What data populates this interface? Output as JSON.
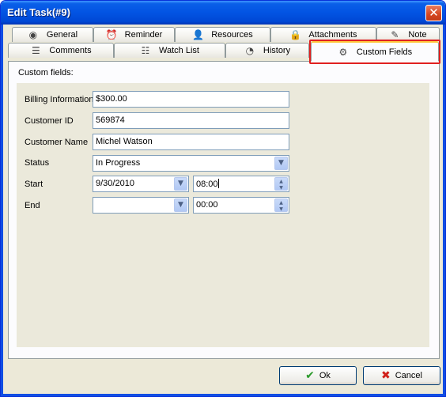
{
  "window": {
    "title": "Edit Task(#9)",
    "close_glyph": "✕"
  },
  "tabs_row1": [
    {
      "label": "General",
      "icon": "globe-icon",
      "glyph": "◉"
    },
    {
      "label": "Reminder",
      "icon": "alarm-clock-icon",
      "glyph": "⏰"
    },
    {
      "label": "Resources",
      "icon": "person-icon",
      "glyph": "👤"
    },
    {
      "label": "Attachments",
      "icon": "lock-icon",
      "glyph": "🔒"
    },
    {
      "label": "Note",
      "icon": "note-pen-icon",
      "glyph": "✎"
    }
  ],
  "tabs_row2": [
    {
      "label": "Comments",
      "icon": "comments-icon",
      "glyph": "☰"
    },
    {
      "label": "Watch List",
      "icon": "watch-list-icon",
      "glyph": "☷"
    },
    {
      "label": "History",
      "icon": "history-clock-icon",
      "glyph": "◔"
    },
    {
      "label": "Custom Fields",
      "icon": "gear-icon",
      "glyph": "⚙",
      "active": true
    }
  ],
  "section_label": "Custom fields:",
  "fields": {
    "billing": {
      "label": "Billing Information",
      "value": "$300.00"
    },
    "customer_id": {
      "label": "Customer ID",
      "value": "569874"
    },
    "customer_name": {
      "label": "Customer Name",
      "value": "Michel Watson"
    },
    "status": {
      "label": "Status",
      "value": "In Progress"
    },
    "start": {
      "label": "Start",
      "date": "9/30/2010",
      "time": "08:00"
    },
    "end": {
      "label": "End",
      "date": "",
      "time": "00:00"
    }
  },
  "buttons": {
    "ok": {
      "label": "Ok",
      "glyph": "✔"
    },
    "cancel": {
      "label": "Cancel",
      "glyph": "✖"
    }
  },
  "colors": {
    "titlebar": "#0254e3",
    "highlight": "#e02020",
    "ok_icon": "#2a9a2a",
    "cancel_icon": "#d0201a"
  },
  "glyphs": {
    "dropdown": "▼",
    "spin_up": "▲",
    "spin_down": "▼"
  }
}
